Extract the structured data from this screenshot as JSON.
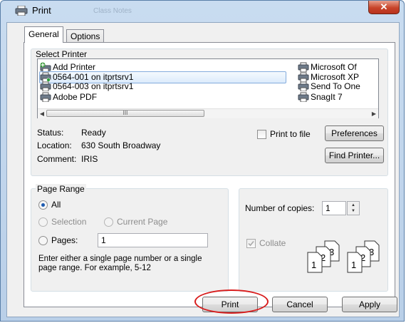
{
  "window": {
    "title": "Print",
    "ghost_title": "Class Notes"
  },
  "tabs": [
    {
      "label": "General"
    },
    {
      "label": "Options"
    }
  ],
  "select_printer": {
    "legend": "Select Printer",
    "left_items": [
      {
        "label": "Add Printer",
        "icon": "add-printer-icon"
      },
      {
        "label": "0564-001 on itprtsrv1",
        "icon": "printer-icon",
        "selected": true
      },
      {
        "label": "0564-003 on itprtsrv1",
        "icon": "printer-icon"
      },
      {
        "label": "Adobe PDF",
        "icon": "printer-icon"
      }
    ],
    "right_items": [
      {
        "label": "Microsoft Of",
        "icon": "printer-icon"
      },
      {
        "label": "Microsoft XP",
        "icon": "printer-icon"
      },
      {
        "label": "Send To One",
        "icon": "printer-icon"
      },
      {
        "label": "SnagIt 7",
        "icon": "printer-icon"
      }
    ],
    "scroll_thumb_glyph": "III"
  },
  "status": {
    "status_label": "Status:",
    "status_value": "Ready",
    "location_label": "Location:",
    "location_value": "630 South Broadway",
    "comment_label": "Comment:",
    "comment_value": "IRIS",
    "print_to_file": "Print to file",
    "preferences": "Preferences",
    "find_printer": "Find Printer..."
  },
  "page_range": {
    "legend": "Page Range",
    "all": "All",
    "selection": "Selection",
    "current_page": "Current Page",
    "pages": "Pages:",
    "pages_value": "1",
    "hint_line1": "Enter either a single page number or a single",
    "hint_line2": "page range.  For example, 5-12"
  },
  "copies": {
    "label": "Number of copies:",
    "value": "1",
    "collate": "Collate",
    "page_numbers": [
      "1",
      "2",
      "3"
    ]
  },
  "footer": {
    "print": "Print",
    "cancel": "Cancel",
    "apply": "Apply"
  },
  "colors": {
    "highlight_oval": "#d81d1d",
    "selection_border": "#84acdd"
  }
}
